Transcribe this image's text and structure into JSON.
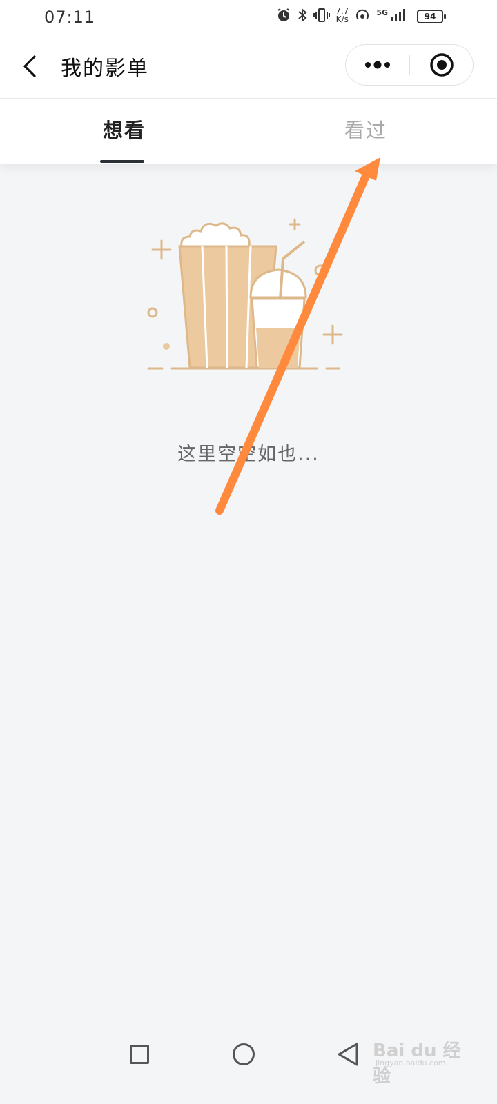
{
  "status_bar": {
    "time": "07:11",
    "net_speed_top": "7.7",
    "net_speed_bottom": "K/s",
    "signal": "5G",
    "battery": "94",
    "icons": [
      "alarm-icon",
      "bluetooth-icon",
      "vibrate-icon",
      "hotspot-icon",
      "signal-icon",
      "battery-icon"
    ]
  },
  "header": {
    "title": "我的影单",
    "back_icon": "chevron-left-icon",
    "more_icon": "more-dots-icon",
    "close_icon": "target-close-icon"
  },
  "tabs": [
    {
      "label": "想看",
      "active": true
    },
    {
      "label": "看过",
      "active": false
    }
  ],
  "empty_state": {
    "message": "这里空空如也...",
    "illustration": "popcorn-and-drink-illustration"
  },
  "annotation": {
    "arrow_color": "#ff8a3d"
  },
  "system_nav": {
    "icons": [
      "recent-apps-icon",
      "home-icon",
      "back-triangle-icon"
    ]
  },
  "watermark": {
    "text": "Bai du 经验",
    "sub": "jingyan.baidu.com"
  },
  "colors": {
    "accent": "#2b2f36",
    "illustration": "#e8c9a0",
    "background": "#f4f5f7"
  }
}
